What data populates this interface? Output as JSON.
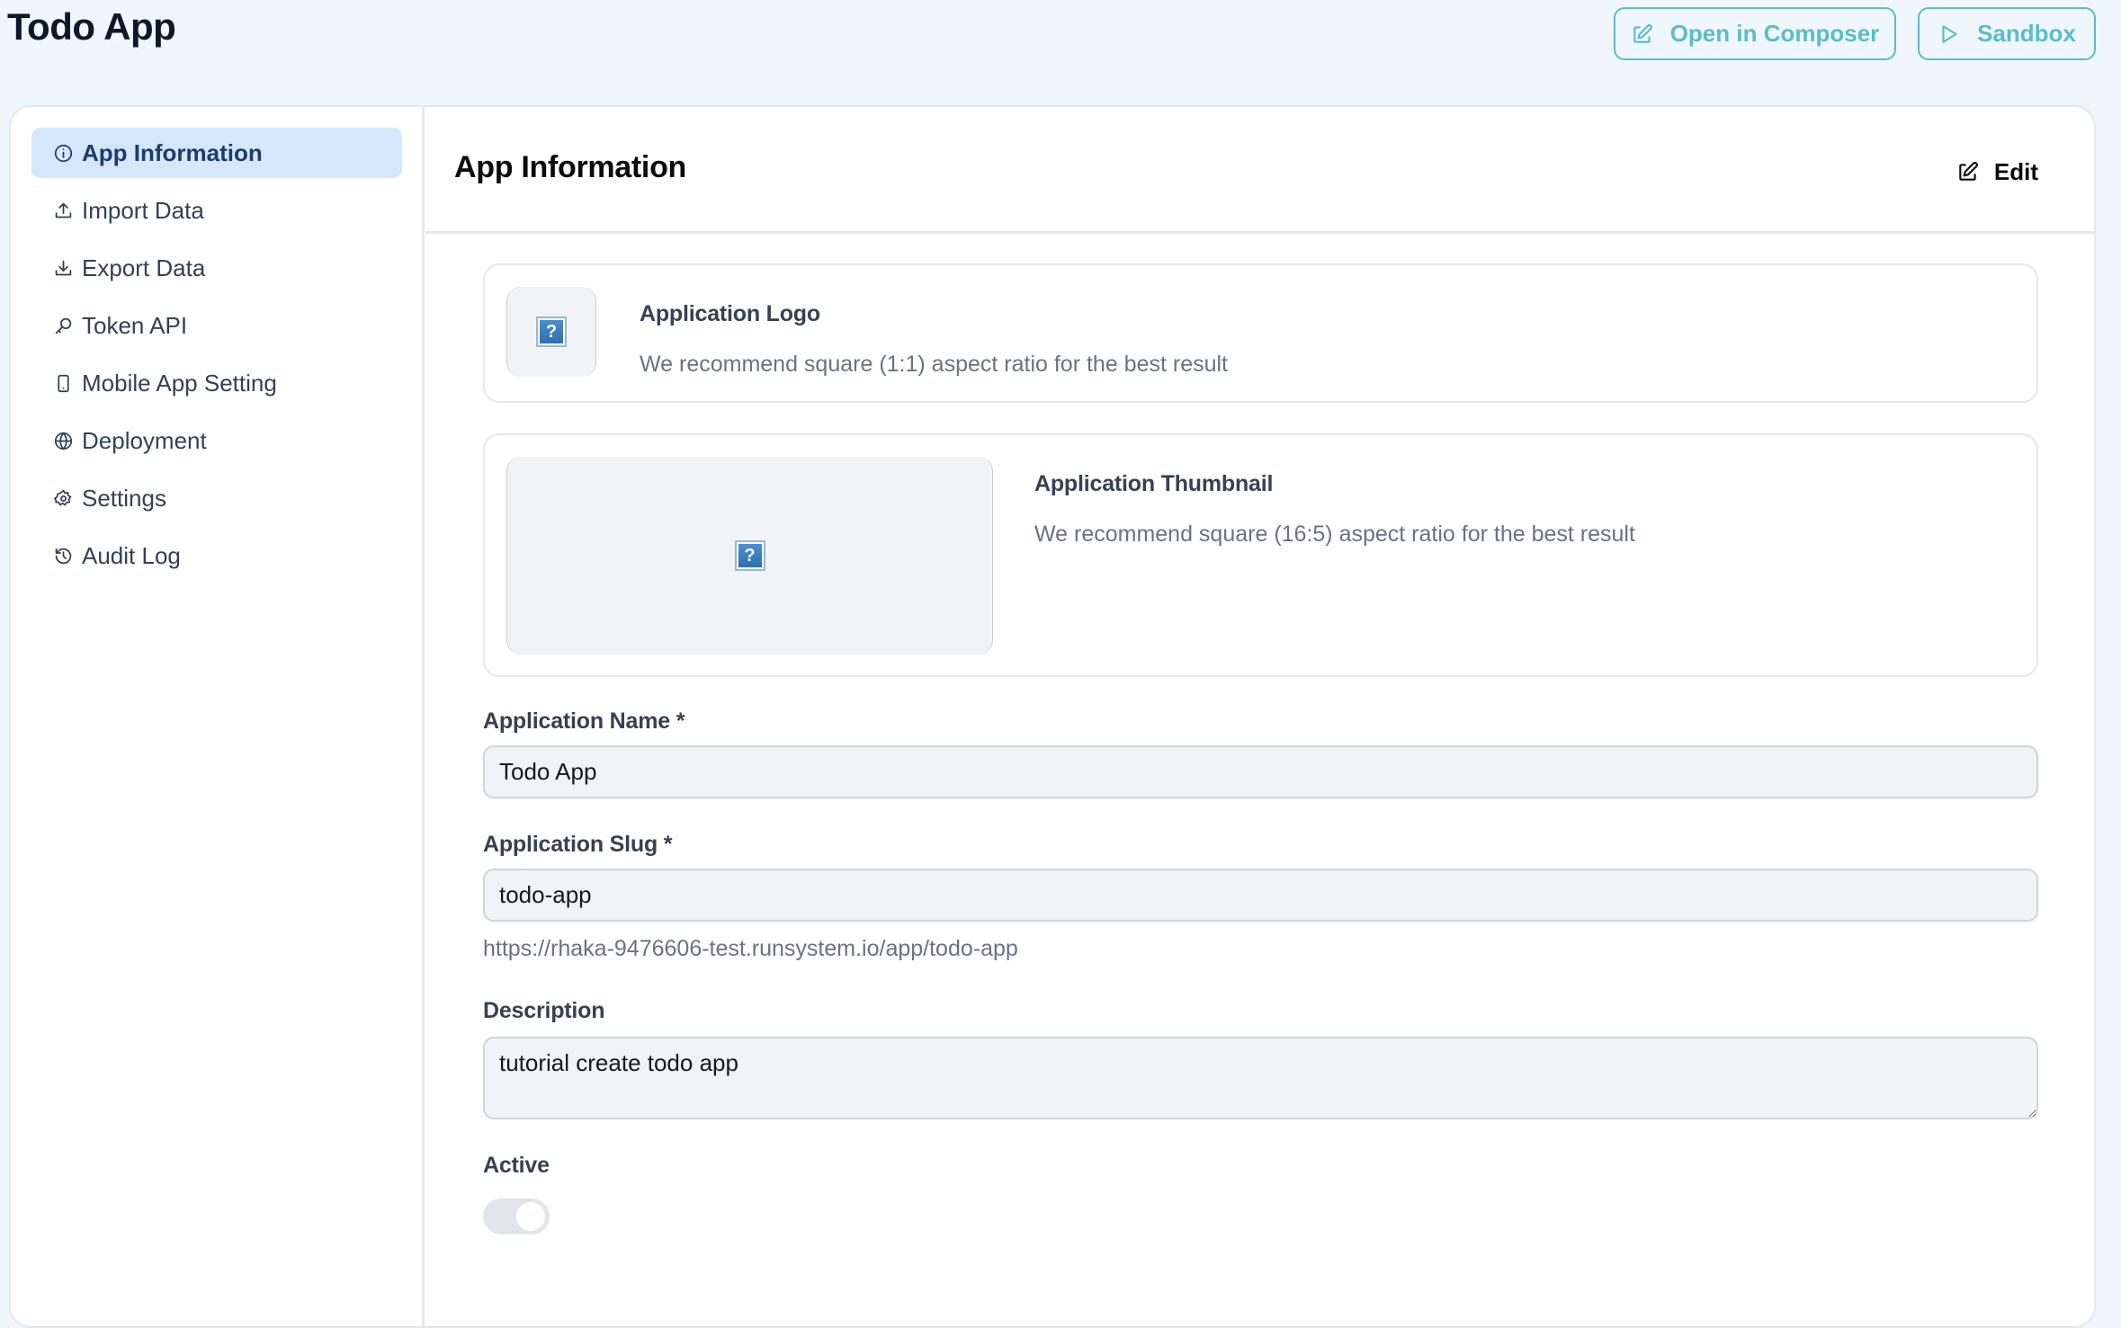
{
  "app": {
    "title": "Todo App"
  },
  "toolbar": {
    "open_in_composer": "Open in Composer",
    "sandbox": "Sandbox"
  },
  "colors": {
    "accent": "#5bbcc8",
    "active_nav_bg": "#d6e7fb",
    "active_nav_text": "#1e3a6e",
    "page_bg": "#eff6fd"
  },
  "sidebar": {
    "items": [
      {
        "label": "App Information",
        "icon": "info-circle-icon",
        "active": true
      },
      {
        "label": "Import Data",
        "icon": "upload-icon",
        "active": false
      },
      {
        "label": "Export Data",
        "icon": "download-icon",
        "active": false
      },
      {
        "label": "Token API",
        "icon": "key-icon",
        "active": false
      },
      {
        "label": "Mobile App Setting",
        "icon": "mobile-icon",
        "active": false
      },
      {
        "label": "Deployment",
        "icon": "globe-icon",
        "active": false
      },
      {
        "label": "Settings",
        "icon": "gear-icon",
        "active": false
      },
      {
        "label": "Audit Log",
        "icon": "history-icon",
        "active": false
      }
    ]
  },
  "main": {
    "title": "App Information",
    "edit_label": "Edit",
    "logo": {
      "title": "Application Logo",
      "hint": "We recommend square (1:1) aspect ratio for the best result",
      "placeholder_glyph": "?"
    },
    "thumbnail": {
      "title": "Application Thumbnail",
      "hint": "We recommend square (16:5) aspect ratio for the best result",
      "placeholder_glyph": "?"
    },
    "form": {
      "name_label": "Application Name *",
      "name_value": "Todo App",
      "slug_label": "Application Slug *",
      "slug_value": "todo-app",
      "slug_url": "https://rhaka-9476606-test.runsystem.io/app/todo-app",
      "description_label": "Description",
      "description_value": "tutorial create todo app",
      "active_label": "Active",
      "active_value": true,
      "active_disabled": true
    }
  }
}
